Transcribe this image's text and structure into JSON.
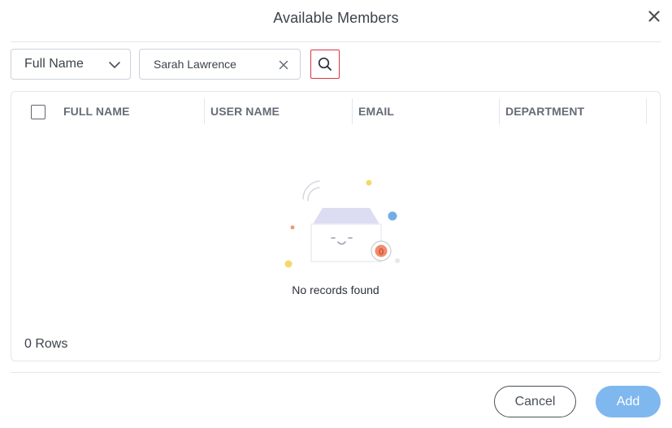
{
  "dialog": {
    "title": "Available Members"
  },
  "filter": {
    "field_selected": "Full Name",
    "search_value": "Sarah Lawrence"
  },
  "grid": {
    "columns": [
      "FULL NAME",
      "USER NAME",
      "EMAIL",
      "DEPARTMENT"
    ],
    "rows": [],
    "empty_message": "No records found",
    "empty_badge_count": "0",
    "rows_count_label": "0 Rows"
  },
  "footer": {
    "cancel_label": "Cancel",
    "add_label": "Add"
  },
  "colors": {
    "accent_primary": "#7fb7ef",
    "search_highlight": "#d9363e",
    "badge": "#f28b6c"
  }
}
